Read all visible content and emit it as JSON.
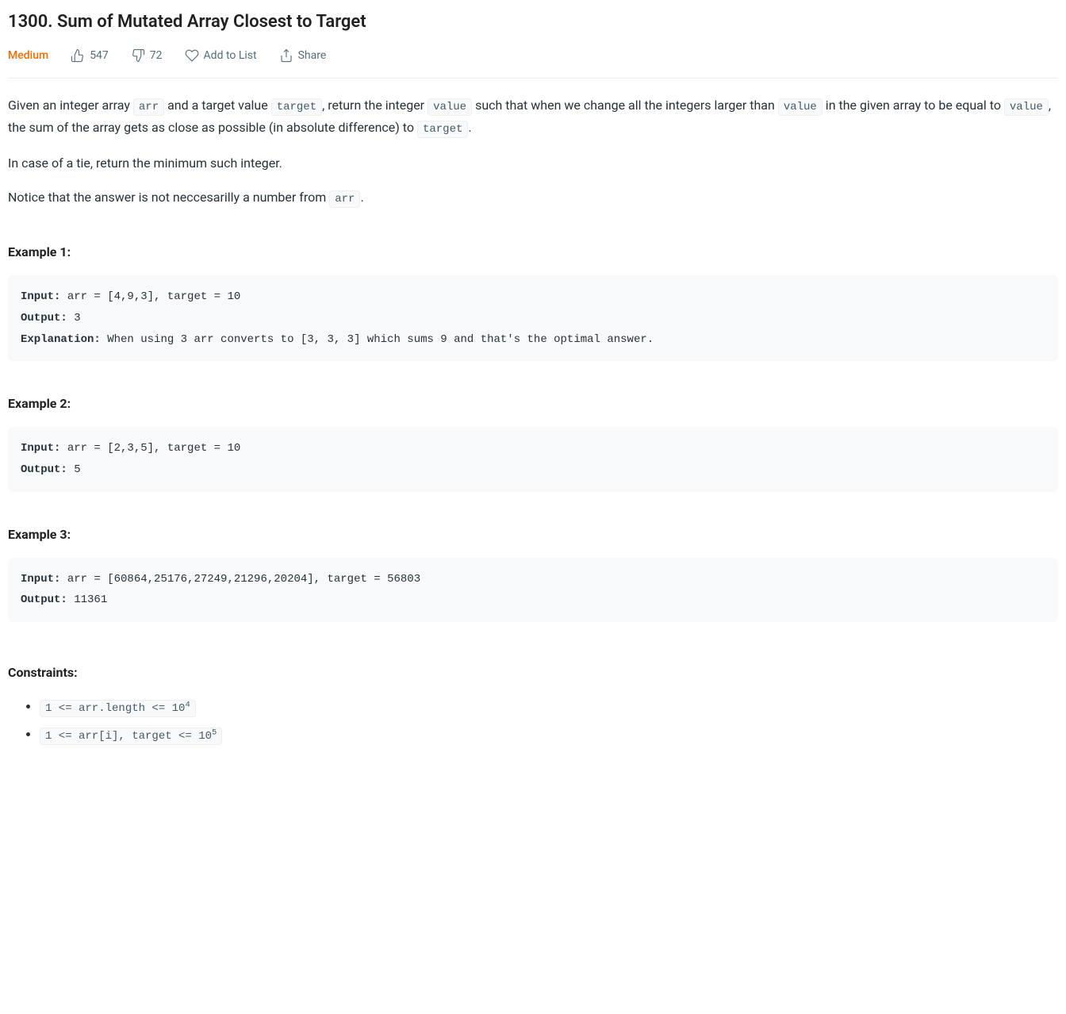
{
  "title": "1300. Sum of Mutated Array Closest to Target",
  "meta": {
    "difficulty": "Medium",
    "likes": "547",
    "dislikes": "72",
    "addToList": "Add to List",
    "share": "Share"
  },
  "description": {
    "p1_part1": "Given an integer array ",
    "p1_code1": "arr",
    "p1_part2": " and a target value ",
    "p1_code2": "target",
    "p1_part3": ", return the integer ",
    "p1_code3": "value",
    "p1_part4": " such that when we change all the integers larger than ",
    "p1_code4": "value",
    "p1_part5": " in the given array to be equal to ",
    "p1_code5": "value",
    "p1_part6": ", the sum of the array gets as close as possible (in absolute difference) to ",
    "p1_code6": "target",
    "p1_part7": ".",
    "p2": "In case of a tie, return the minimum such integer.",
    "p3_part1": "Notice that the answer is not neccesarilly a number from ",
    "p3_code1": "arr",
    "p3_part2": "."
  },
  "examples": [
    {
      "heading": "Example 1:",
      "inputLabel": "Input:",
      "input": " arr = [4,9,3], target = 10",
      "outputLabel": "Output:",
      "output": " 3",
      "explanationLabel": "Explanation:",
      "explanation": " When using 3 arr converts to [3, 3, 3] which sums 9 and that's the optimal answer."
    },
    {
      "heading": "Example 2:",
      "inputLabel": "Input:",
      "input": " arr = [2,3,5], target = 10",
      "outputLabel": "Output:",
      "output": " 5"
    },
    {
      "heading": "Example 3:",
      "inputLabel": "Input:",
      "input": " arr = [60864,25176,27249,21296,20204], target = 56803",
      "outputLabel": "Output:",
      "output": " 11361"
    }
  ],
  "constraints": {
    "heading": "Constraints:",
    "items": [
      {
        "pre": "1 <= arr.length <= 10",
        "sup": "4"
      },
      {
        "pre": "1 <= arr[i], target <= 10",
        "sup": "5"
      }
    ]
  }
}
